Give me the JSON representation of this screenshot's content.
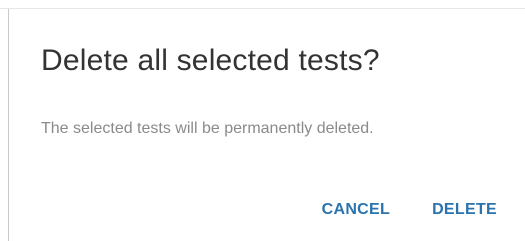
{
  "dialog": {
    "title": "Delete all selected tests?",
    "message": "The selected tests will be permanently deleted.",
    "cancel_label": "CANCEL",
    "delete_label": "DELETE"
  },
  "colors": {
    "title": "#333333",
    "message": "#8a8a8a",
    "action": "#2a73ad",
    "background": "#ffffff"
  }
}
